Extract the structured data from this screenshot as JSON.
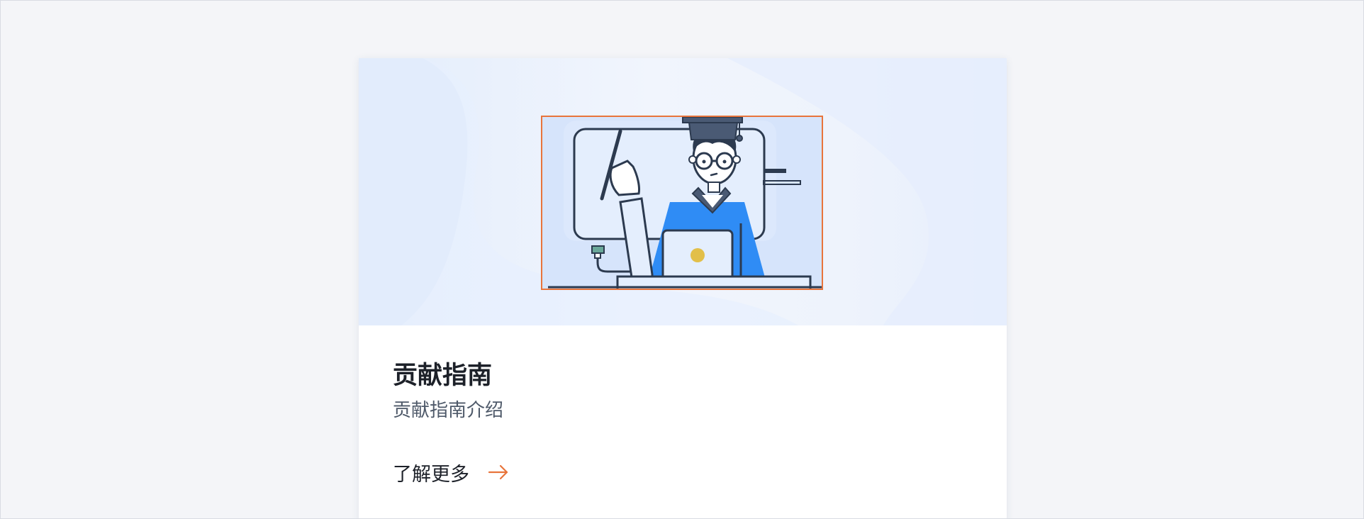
{
  "card": {
    "title": "贡献指南",
    "subtitle": "贡献指南介绍",
    "link_label": "了解更多",
    "link_icon": "arrow-right-icon"
  },
  "illustration": {
    "subject": "graduate-teacher-illustration"
  },
  "colors": {
    "accent": "#e8743b",
    "figure_blue": "#2f8cf5",
    "line_dark": "#2c3a4f",
    "banner_bg": "#e8effc",
    "screen_bg": "#d6e4fb"
  }
}
